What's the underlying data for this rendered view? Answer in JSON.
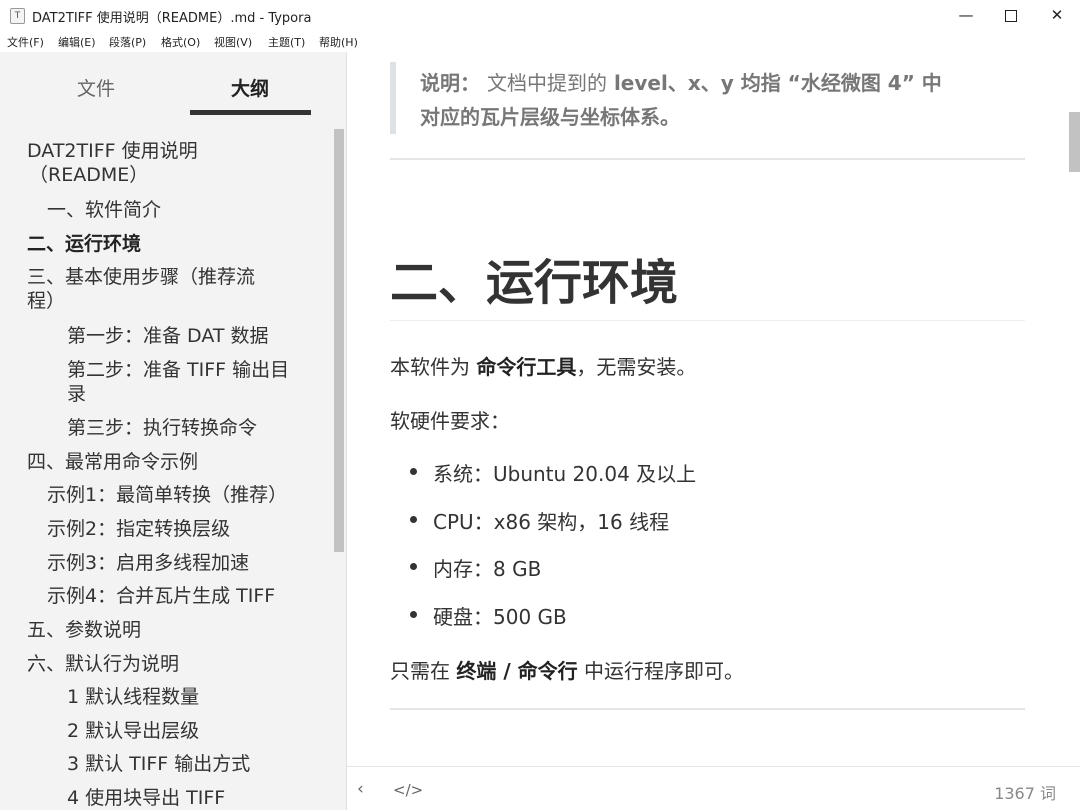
{
  "window": {
    "title": "DAT2TIFF 使用说明（README）.md - Typora",
    "app_icon_text": "T",
    "min_symbol": "—",
    "close_symbol": "✕"
  },
  "menu": [
    "文件(F)",
    "编辑(E)",
    "段落(P)",
    "格式(O)",
    "视图(V)",
    "主题(T)",
    "帮助(H)"
  ],
  "sidebar": {
    "tab_files": "文件",
    "tab_outline": "大纲",
    "outline": [
      {
        "text": "DAT2TIFF 使用说明",
        "level": 1
      },
      {
        "text": "（README）",
        "level": 1
      },
      {
        "text": "一、软件简介",
        "level": 2
      },
      {
        "text": "二、运行环境",
        "level": 1,
        "active": true
      },
      {
        "text": "三、基本使用步骤（推荐流",
        "level": 1
      },
      {
        "text": "程）",
        "level": 1
      },
      {
        "text": "第一步：准备 DAT 数据",
        "level": 3
      },
      {
        "text": "第二步：准备 TIFF 输出目",
        "level": 3
      },
      {
        "text": "录",
        "level": 3
      },
      {
        "text": "第三步：执行转换命令",
        "level": 3
      },
      {
        "text": "四、最常用命令示例",
        "level": 1
      },
      {
        "text": "示例1：最简单转换（推荐）",
        "level": 2
      },
      {
        "text": "示例2：指定转换层级",
        "level": 2
      },
      {
        "text": "示例3：启用多线程加速",
        "level": 2
      },
      {
        "text": "示例4：合并瓦片生成 TIFF",
        "level": 2
      },
      {
        "text": "五、参数说明",
        "level": 1
      },
      {
        "text": "六、默认行为说明",
        "level": 1
      },
      {
        "text": "1 默认线程数量",
        "level": 3
      },
      {
        "text": "2 默认导出层级",
        "level": 3
      },
      {
        "text": "3 默认 TIFF 输出方式",
        "level": 3
      },
      {
        "text": "4 使用块导出 TIFF",
        "level": 3
      }
    ]
  },
  "editor": {
    "quote": {
      "label": "说明：",
      "line1_normal": "文档中提到的",
      "line1_bold": "level、x、y 均指 “水经微图 4” 中",
      "line2": "对应的瓦片层级与坐标体系。"
    },
    "heading": "二、运行环境",
    "p1_pre": "本软件为",
    "p1_bold": "命令行工具",
    "p1_post": "，无需安装。",
    "p2": "软硬件要求：",
    "requirements": [
      "系统：Ubuntu 20.04 及以上",
      "CPU：x86 架构，16 线程",
      "内存：8 GB",
      "硬盘：500 GB"
    ],
    "p3_pre": "只需在",
    "p3_bold": "终端 / 命令行",
    "p3_post": "中运行程序即可。"
  },
  "status": {
    "back_symbol": "‹",
    "code_symbol": "</>",
    "word_count": "1367 词"
  }
}
